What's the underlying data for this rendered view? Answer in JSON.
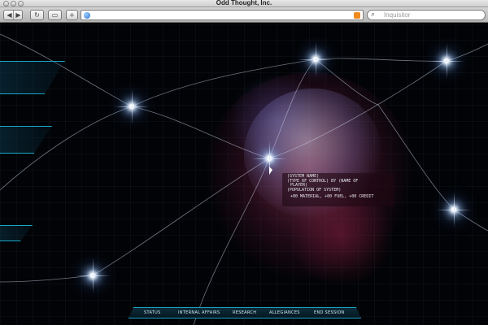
{
  "window": {
    "title": "Odd Thought, Inc."
  },
  "toolbar": {
    "back_icon": "back-arrow-icon",
    "forward_icon": "forward-arrow-icon",
    "reload_glyph": "↻",
    "tabs_glyph": "▭",
    "add_glyph": "+",
    "address_value": "",
    "search_placeholder": "Inquisitor",
    "search_glyph": "⌕"
  },
  "tooltip": {
    "lines": [
      "(SYSTEM NAME)",
      "(TYPE OF CONTROL) BY (NAME OF",
      "PLAYER)",
      "(POPULATION OF SYSTEM)"
    ],
    "resources": "+00 MATERIAL, +00 FUEL, +00 CREDIT"
  },
  "nav": {
    "items": [
      "STATUS",
      "INTERNAL AFFAIRS",
      "RESEARCH",
      "ALLEGIANCES",
      "END SESSION"
    ]
  },
  "colors": {
    "accent": "#18a8c8",
    "background": "#020306"
  }
}
